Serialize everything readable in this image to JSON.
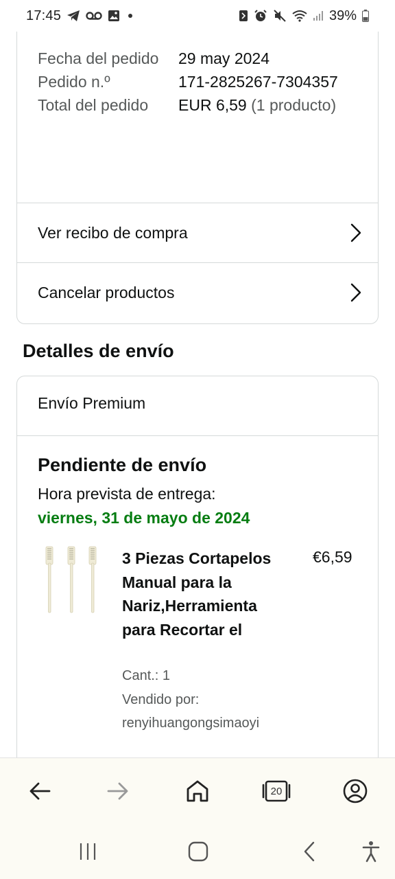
{
  "status_bar": {
    "time": "17:45",
    "battery_percent": "39%",
    "left_icons": [
      "telegram-icon",
      "voicemail-icon",
      "gallery-icon",
      "dot-icon"
    ],
    "right_icons": [
      "nfc-icon",
      "alarm-icon",
      "mute-icon",
      "wifi-icon",
      "signal-icon",
      "battery-icon"
    ]
  },
  "order_summary": {
    "rows": [
      {
        "label": "Fecha del pedido",
        "value": "29 may 2024"
      },
      {
        "label": "Pedido n.º",
        "value": "171-2825267-7304357"
      },
      {
        "label": "Total del pedido",
        "value": "EUR 6,59",
        "value_suffix": "(1 producto)"
      }
    ],
    "view_receipt": "Ver recibo de compra",
    "cancel_items": "Cancelar productos"
  },
  "shipping": {
    "section_title": "Detalles de envío",
    "type": "Envío Premium",
    "status": "Pendiente de envío",
    "eta_label": "Hora prevista de entrega:",
    "eta_date": "viernes, 31 de mayo de 2024",
    "eta_color": "#067d12",
    "product": {
      "title": "3 Piezas Cortapelos Manual para la Nariz,Herramienta para Recortar el",
      "price": "€6,59",
      "quantity": "Cant.: 1",
      "seller_label": "Vendido por:",
      "seller": "renyihuangongsimaoyi",
      "image": "nose-trimmer-product-image"
    }
  },
  "browser_toolbar": {
    "back": "back-arrow-icon",
    "forward": "forward-arrow-icon",
    "home": "home-icon",
    "tabs_count": "20",
    "account": "account-icon"
  },
  "system_nav": {
    "recents": "recents-icon",
    "home": "home-circle-icon",
    "back": "back-chevron-icon",
    "accessibility": "accessibility-icon"
  }
}
